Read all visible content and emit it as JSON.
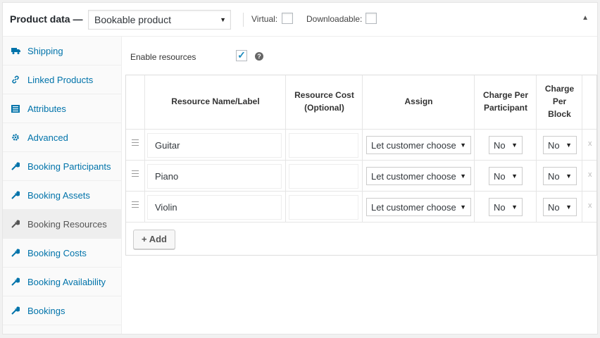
{
  "header": {
    "title": "Product data —",
    "product_type": "Bookable product",
    "virtual_label": "Virtual:",
    "downloadable_label": "Downloadable:"
  },
  "sidebar": {
    "items": [
      {
        "label": "Shipping",
        "icon": "truck-icon"
      },
      {
        "label": "Linked Products",
        "icon": "link-icon"
      },
      {
        "label": "Attributes",
        "icon": "list-icon"
      },
      {
        "label": "Advanced",
        "icon": "gear-icon"
      },
      {
        "label": "Booking Participants",
        "icon": "wrench-icon"
      },
      {
        "label": "Booking Assets",
        "icon": "wrench-icon"
      },
      {
        "label": "Booking Resources",
        "icon": "wrench-icon",
        "active": true
      },
      {
        "label": "Booking Costs",
        "icon": "wrench-icon"
      },
      {
        "label": "Booking Availability",
        "icon": "wrench-icon"
      },
      {
        "label": "Bookings",
        "icon": "wrench-icon"
      }
    ]
  },
  "resources": {
    "enable_label": "Enable resources",
    "enabled": true,
    "columns": {
      "name": "Resource Name/Label",
      "cost_1": "Resource Cost",
      "cost_2": "(Optional)",
      "assign": "Assign",
      "per_participant_1": "Charge Per",
      "per_participant_2": "Participant",
      "per_block_1": "Charge",
      "per_block_2": "Per",
      "per_block_3": "Block"
    },
    "rows": [
      {
        "name": "Guitar",
        "cost": "",
        "assign": "Let customer choose",
        "per_participant": "No",
        "per_block": "No"
      },
      {
        "name": "Piano",
        "cost": "",
        "assign": "Let customer choose",
        "per_participant": "No",
        "per_block": "No"
      },
      {
        "name": "Violin",
        "cost": "",
        "assign": "Let customer choose",
        "per_participant": "No",
        "per_block": "No"
      }
    ],
    "remove_label": "x",
    "add_label": "+ Add"
  },
  "colors": {
    "link": "#0073aa",
    "checkmark": "#1e8cbe",
    "active_tab_bg": "#eeeeee"
  }
}
